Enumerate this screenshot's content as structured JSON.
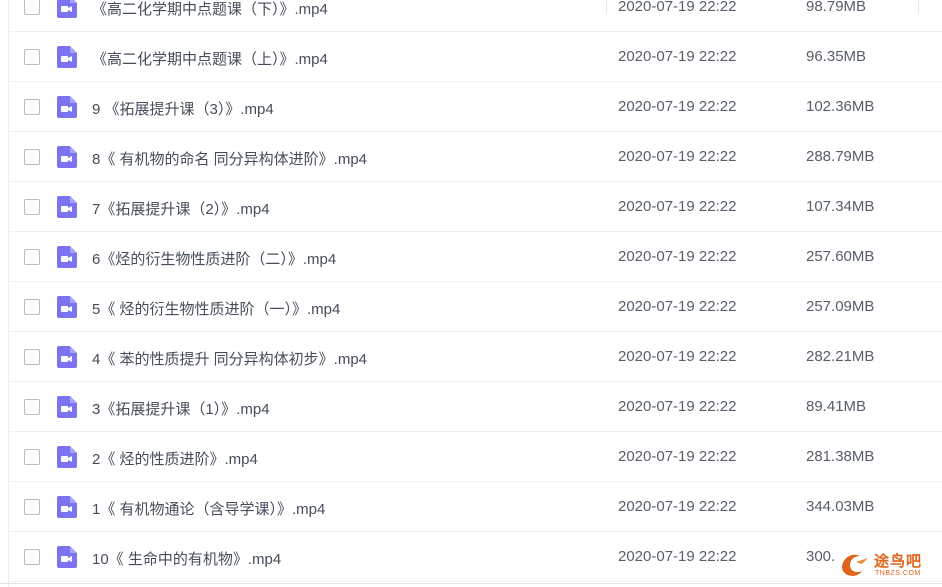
{
  "files": [
    {
      "name": "《高二化学期中点题课（下）》.mp4",
      "date": "2020-07-19 22:22",
      "size": "98.79MB"
    },
    {
      "name": "《高二化学期中点题课（上）》.mp4",
      "date": "2020-07-19 22:22",
      "size": "96.35MB"
    },
    {
      "name": "9 《拓展提升课（3）》.mp4",
      "date": "2020-07-19 22:22",
      "size": "102.36MB"
    },
    {
      "name": "8《 有机物的命名 同分异构体进阶》.mp4",
      "date": "2020-07-19 22:22",
      "size": "288.79MB"
    },
    {
      "name": "7《拓展提升课（2）》.mp4",
      "date": "2020-07-19 22:22",
      "size": "107.34MB"
    },
    {
      "name": "6《烃的衍生物性质进阶（二）》.mp4",
      "date": "2020-07-19 22:22",
      "size": "257.60MB"
    },
    {
      "name": "5《 烃的衍生物性质进阶（一）》.mp4",
      "date": "2020-07-19 22:22",
      "size": "257.09MB"
    },
    {
      "name": "4《 苯的性质提升 同分异构体初步》.mp4",
      "date": "2020-07-19 22:22",
      "size": "282.21MB"
    },
    {
      "name": "3《拓展提升课（1）》.mp4",
      "date": "2020-07-19 22:22",
      "size": "89.41MB"
    },
    {
      "name": "2《 烃的性质进阶》.mp4",
      "date": "2020-07-19 22:22",
      "size": "281.38MB"
    },
    {
      "name": "1《 有机物通论（含导学课）》.mp4",
      "date": "2020-07-19 22:22",
      "size": "344.03MB"
    },
    {
      "name": "10《 生命中的有机物》.mp4",
      "date": "2020-07-19 22:22",
      "size": "300."
    }
  ],
  "file_icon": "video-file-icon",
  "watermark": {
    "text": "途鸟吧",
    "sub": "TNBZS.COM"
  },
  "colors": {
    "icon": "#7b73f0",
    "watermark": "#e0631a"
  }
}
